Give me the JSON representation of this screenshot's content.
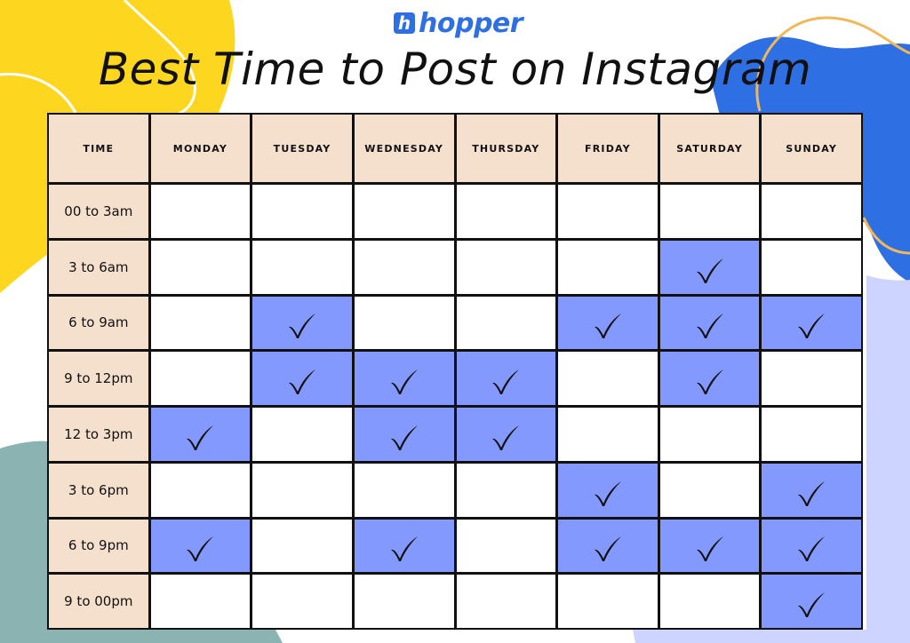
{
  "brand": {
    "logo_mark": "h",
    "logo_text": "hopper",
    "color": "#2f6fe4"
  },
  "title": "Best Time to Post on Instagram",
  "colors": {
    "header_bg": "#f5e0ce",
    "highlight": "#8399fd",
    "yellow_blob": "#fdd61f",
    "blue_blob": "#2f6fe4",
    "lavender_blob": "#ccd4ff",
    "teal_blob": "#8ab3b2",
    "orange_line": "#f0b85a"
  },
  "table": {
    "corner_header": "TIME",
    "days": [
      "MONDAY",
      "TUESDAY",
      "WEDNESDAY",
      "THURSDAY",
      "FRIDAY",
      "SATURDAY",
      "SUNDAY"
    ],
    "rows": [
      {
        "time": "00 to 3am",
        "checks": [
          false,
          false,
          false,
          false,
          false,
          false,
          false
        ]
      },
      {
        "time": "3 to 6am",
        "checks": [
          false,
          false,
          false,
          false,
          false,
          true,
          false
        ]
      },
      {
        "time": "6 to 9am",
        "checks": [
          false,
          true,
          false,
          false,
          true,
          true,
          true
        ]
      },
      {
        "time": "9 to 12pm",
        "checks": [
          false,
          true,
          true,
          true,
          false,
          true,
          false
        ]
      },
      {
        "time": "12 to 3pm",
        "checks": [
          true,
          false,
          true,
          true,
          false,
          false,
          false
        ]
      },
      {
        "time": "3 to 6pm",
        "checks": [
          false,
          false,
          false,
          false,
          true,
          false,
          true
        ]
      },
      {
        "time": "6 to 9pm",
        "checks": [
          true,
          false,
          true,
          false,
          true,
          true,
          true
        ]
      },
      {
        "time": "9 to 00pm",
        "checks": [
          false,
          false,
          false,
          false,
          false,
          false,
          true
        ]
      }
    ],
    "check_icon": "checkmark-icon"
  }
}
